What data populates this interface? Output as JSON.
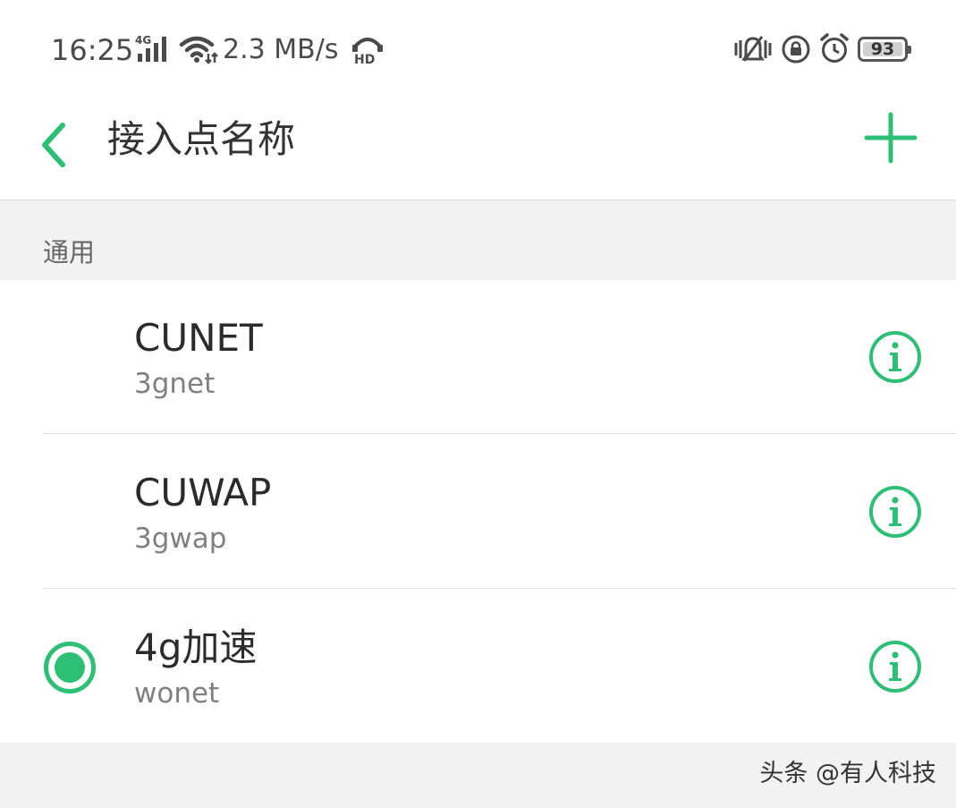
{
  "status_bar": {
    "time": "16:25",
    "network_type": "4G",
    "speed": "2.3 MB/s",
    "hd_badge": "HD",
    "battery_level": "93",
    "icons": [
      "signal-4g-icon",
      "wifi-icon",
      "hd-voice-icon",
      "vibrate-icon",
      "rotation-lock-icon",
      "alarm-icon",
      "battery-icon"
    ]
  },
  "header": {
    "title": "接入点名称",
    "back_icon": "chevron-left-icon",
    "add_icon": "plus-icon"
  },
  "section": {
    "label": "通用"
  },
  "apn_items": [
    {
      "name": "CUNET",
      "apn": "3gnet",
      "selected": false
    },
    {
      "name": "CUWAP",
      "apn": "3gwap",
      "selected": false
    },
    {
      "name": "4g加速",
      "apn": "wonet",
      "selected": true
    }
  ],
  "watermark": "头条 @有人科技",
  "colors": {
    "accent": "#2dbf75",
    "text_primary": "#2b2b2b",
    "text_secondary": "#808080",
    "background": "#f2f2f2"
  }
}
